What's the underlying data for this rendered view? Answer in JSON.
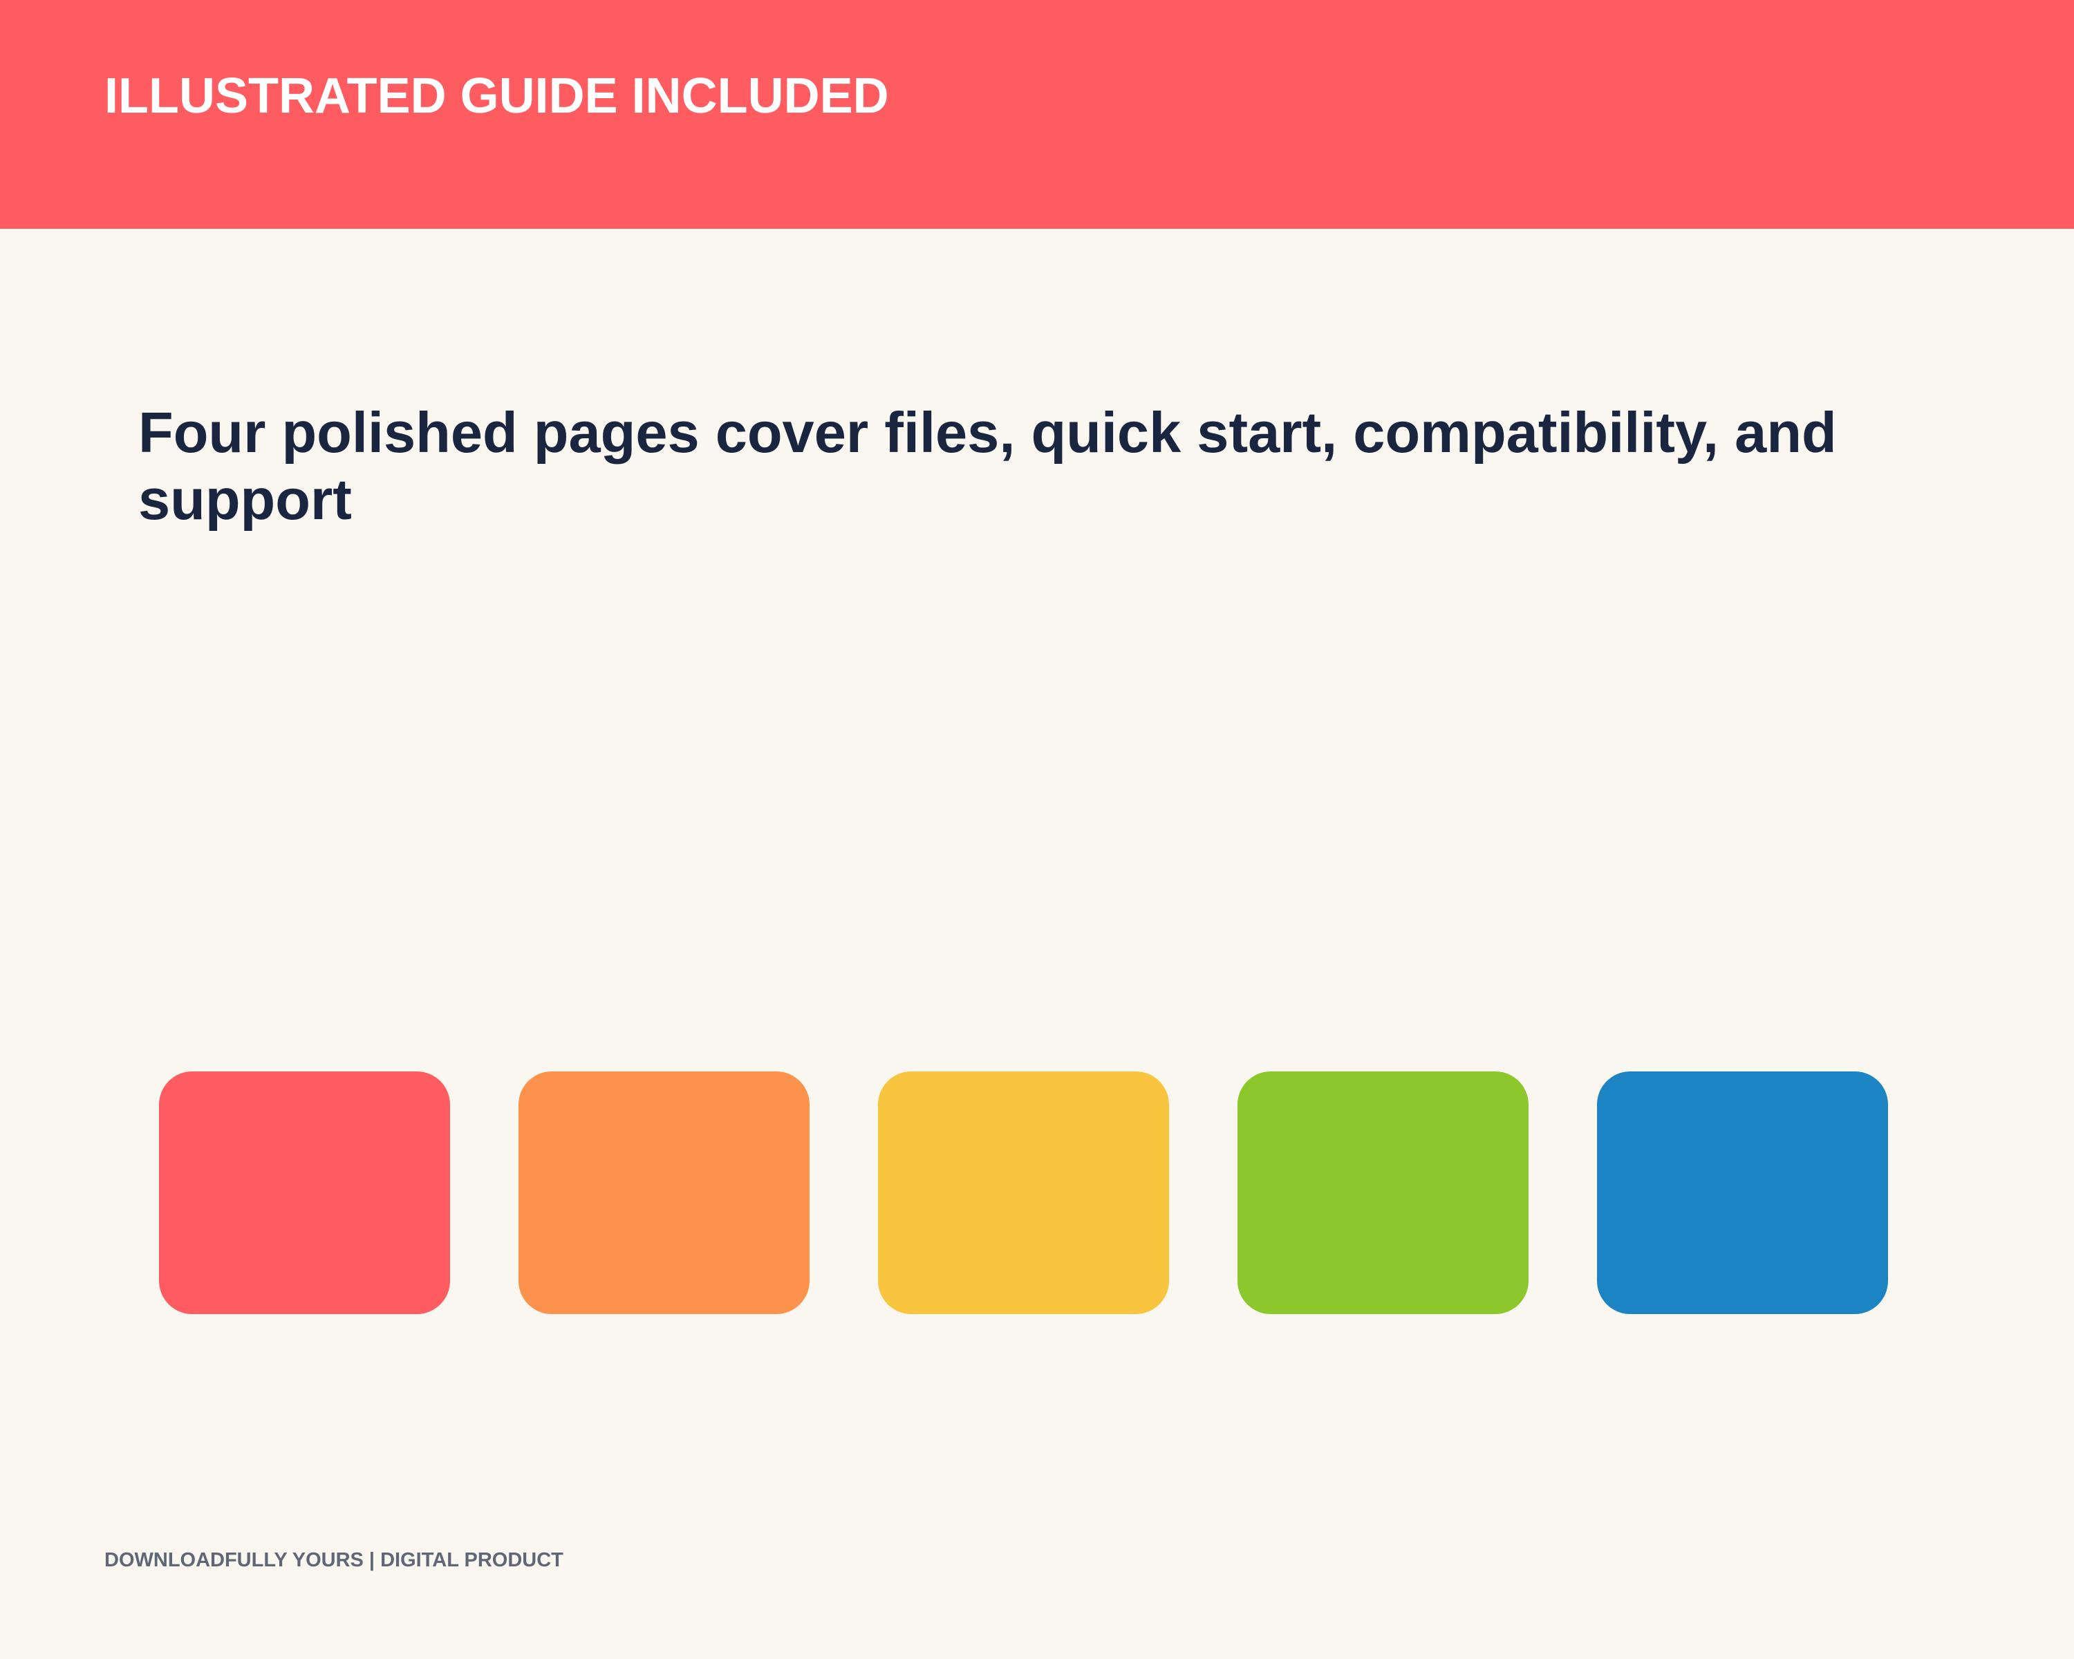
{
  "header": {
    "title": "ILLUSTRATED GUIDE INCLUDED",
    "background_color": "#FF5C62",
    "text_color": "#FFFFFF"
  },
  "main": {
    "headline": "Four polished pages cover files, quick start, compatibility, and support",
    "headline_color": "#1A2540",
    "background_color": "#FAF6F0"
  },
  "swatches": [
    {
      "color": "#FF5C62"
    },
    {
      "color": "#FD924D"
    },
    {
      "color": "#FAC53E"
    },
    {
      "color": "#8CC72C"
    },
    {
      "color": "#1C84C3"
    }
  ],
  "footer": {
    "text": "DOWNLOADFULLY YOURS | DIGITAL PRODUCT",
    "text_color": "#5F6676"
  }
}
